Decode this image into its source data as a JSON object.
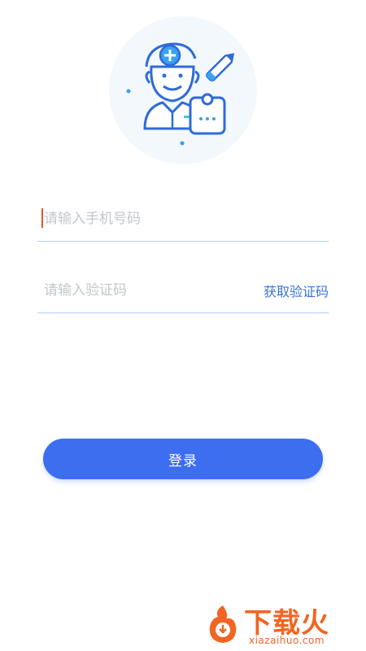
{
  "hero": {
    "illustration": "doctor-with-clipboard-and-pen"
  },
  "form": {
    "phone": {
      "placeholder": "请输入手机号码",
      "value": ""
    },
    "code": {
      "placeholder": "请输入验证码",
      "value": "",
      "get_code_label": "获取验证码"
    },
    "login_label": "登录"
  },
  "watermark": {
    "brand": "下载火",
    "url": "xiazaihuo.com"
  },
  "colors": {
    "accent": "#3d6ef0",
    "link": "#3a74d9",
    "underline": "#b7cdf3",
    "placeholder": "#c2c6cc",
    "caret": "#e2572a",
    "watermark": "#f26522"
  }
}
